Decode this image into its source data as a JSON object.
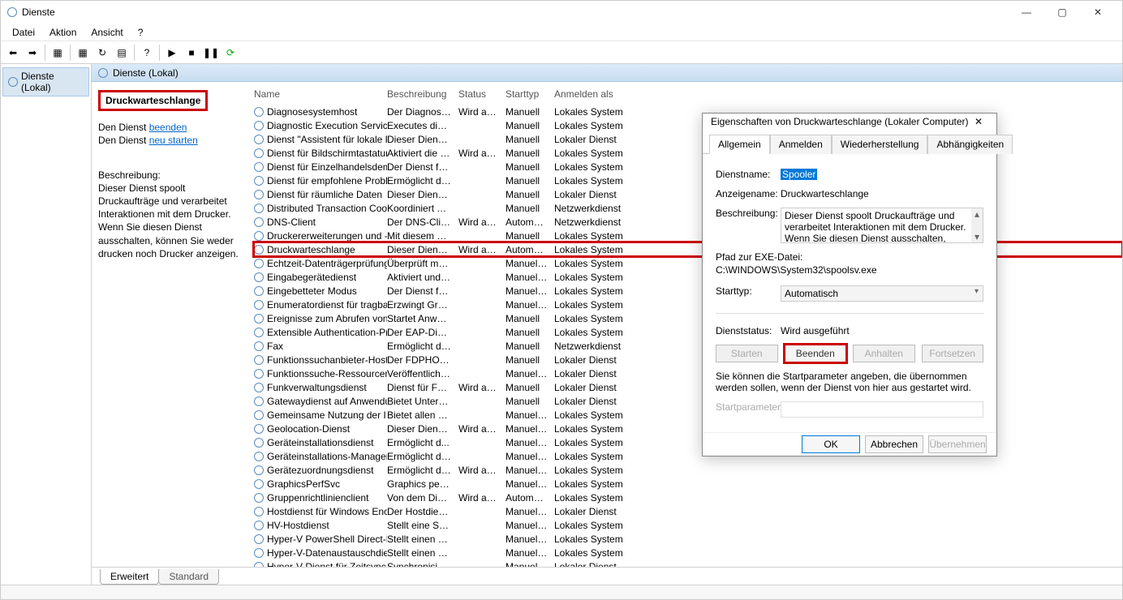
{
  "window_title": "Dienste",
  "menubar": {
    "file": "Datei",
    "action": "Aktion",
    "view": "Ansicht",
    "help": "?"
  },
  "tree": {
    "item0": "Dienste (Lokal)"
  },
  "panel_header": "Dienste (Lokal)",
  "detail": {
    "selected_service": "Druckwarteschlange",
    "line1_prefix": "Den Dienst ",
    "line1_link": "beenden",
    "line2_prefix": "Den Dienst ",
    "line2_link": "neu starten",
    "desc_label": "Beschreibung:",
    "desc_text": "Dieser Dienst spoolt Druckaufträge und verarbeitet Interaktionen mit dem Drucker. Wenn Sie diesen Dienst ausschalten, können Sie weder drucken noch Drucker anzeigen."
  },
  "columns": {
    "name": "Name",
    "desc": "Beschreibung",
    "status": "Status",
    "start": "Starttyp",
    "logon": "Anmelden als"
  },
  "rows": [
    {
      "name": "Diagnosesystemhost",
      "desc": "Der Diagnoses...",
      "status": "Wird au...",
      "start": "Manuell",
      "logon": "Lokales System",
      "hl": false
    },
    {
      "name": "Diagnostic Execution Service",
      "desc": "Executes diagn...",
      "status": "",
      "start": "Manuell",
      "logon": "Lokales System",
      "hl": false
    },
    {
      "name": "Dienst \"Assistent für lokale P...",
      "desc": "Dieser Dienst e...",
      "status": "",
      "start": "Manuell",
      "logon": "Lokaler Dienst",
      "hl": false
    },
    {
      "name": "Dienst für Bildschirmtastatur...",
      "desc": "Aktiviert die Sti...",
      "status": "Wird au...",
      "start": "Manuell",
      "logon": "Lokales System",
      "hl": false
    },
    {
      "name": "Dienst für Einzelhandelsdem...",
      "desc": "Der Dienst für ...",
      "status": "",
      "start": "Manuell",
      "logon": "Lokales System",
      "hl": false
    },
    {
      "name": "Dienst für empfohlene Probl...",
      "desc": "Ermöglicht de...",
      "status": "",
      "start": "Manuell",
      "logon": "Lokales System",
      "hl": false
    },
    {
      "name": "Dienst für räumliche Daten",
      "desc": "Dieser Dienst ...",
      "status": "",
      "start": "Manuell",
      "logon": "Lokaler Dienst",
      "hl": false
    },
    {
      "name": "Distributed Transaction Coor...",
      "desc": "Koordiniert Tra...",
      "status": "",
      "start": "Manuell",
      "logon": "Netzwerkdienst",
      "hl": false
    },
    {
      "name": "DNS-Client",
      "desc": "Der DNS-Clien...",
      "status": "Wird au...",
      "start": "Automat...",
      "logon": "Netzwerkdienst",
      "hl": false
    },
    {
      "name": "Druckererweiterungen und -...",
      "desc": "Mit diesem Die...",
      "status": "",
      "start": "Manuell",
      "logon": "Lokales System",
      "hl": false
    },
    {
      "name": "Druckwarteschlange",
      "desc": "Dieser Dienst s...",
      "status": "Wird au...",
      "start": "Automat...",
      "logon": "Lokales System",
      "hl": true
    },
    {
      "name": "Echtzeit-Datenträgerprüfung",
      "desc": "Überprüft mög...",
      "status": "",
      "start": "Manuell (...",
      "logon": "Lokales System",
      "hl": false
    },
    {
      "name": "Eingabegerätedienst",
      "desc": "Aktiviert und v...",
      "status": "",
      "start": "Manuell (...",
      "logon": "Lokales System",
      "hl": false
    },
    {
      "name": "Eingebetteter Modus",
      "desc": "Der Dienst für ...",
      "status": "",
      "start": "Manuell (...",
      "logon": "Lokales System",
      "hl": false
    },
    {
      "name": "Enumeratordienst für tragba...",
      "desc": "Erzwingt Grup...",
      "status": "",
      "start": "Manuell (...",
      "logon": "Lokales System",
      "hl": false
    },
    {
      "name": "Ereignisse zum Abrufen von s...",
      "desc": "Startet Anwen...",
      "status": "",
      "start": "Manuell",
      "logon": "Lokales System",
      "hl": false
    },
    {
      "name": "Extensible Authentication-Pr...",
      "desc": "Der EAP-Dienst...",
      "status": "",
      "start": "Manuell",
      "logon": "Lokales System",
      "hl": false
    },
    {
      "name": "Fax",
      "desc": "Ermöglicht das...",
      "status": "",
      "start": "Manuell",
      "logon": "Netzwerkdienst",
      "hl": false
    },
    {
      "name": "Funktionssuchanbieter-Host",
      "desc": "Der FDPHOST-...",
      "status": "",
      "start": "Manuell",
      "logon": "Lokaler Dienst",
      "hl": false
    },
    {
      "name": "Funktionssuche-Ressourcen...",
      "desc": "Veröffentlicht ...",
      "status": "",
      "start": "Manuell (...",
      "logon": "Lokaler Dienst",
      "hl": false
    },
    {
      "name": "Funkverwaltungsdienst",
      "desc": "Dienst für Fun...",
      "status": "Wird au...",
      "start": "Manuell",
      "logon": "Lokaler Dienst",
      "hl": false
    },
    {
      "name": "Gatewaydienst auf Anwendu...",
      "desc": "Bietet Unterstü...",
      "status": "",
      "start": "Manuell",
      "logon": "Lokaler Dienst",
      "hl": false
    },
    {
      "name": "Gemeinsame Nutzung der I...",
      "desc": "Bietet allen Co...",
      "status": "",
      "start": "Manuell (...",
      "logon": "Lokales System",
      "hl": false
    },
    {
      "name": "Geolocation-Dienst",
      "desc": "Dieser Dienst ü...",
      "status": "Wird au...",
      "start": "Manuell (...",
      "logon": "Lokales System",
      "hl": false
    },
    {
      "name": "Geräteinstallationsdienst",
      "desc": "Ermöglicht d...",
      "status": "",
      "start": "Manuell (...",
      "logon": "Lokales System",
      "hl": false
    },
    {
      "name": "Geräteinstallations-Manager",
      "desc": "Ermöglicht das...",
      "status": "",
      "start": "Manuell (...",
      "logon": "Lokales System",
      "hl": false
    },
    {
      "name": "Gerätezuordnungsdienst",
      "desc": "Ermöglicht die ...",
      "status": "Wird au...",
      "start": "Manuell (...",
      "logon": "Lokales System",
      "hl": false
    },
    {
      "name": "GraphicsPerfSvc",
      "desc": "Graphics perfo...",
      "status": "",
      "start": "Manuell (...",
      "logon": "Lokales System",
      "hl": false
    },
    {
      "name": "Gruppenrichtlinienclient",
      "desc": "Von dem Diens...",
      "status": "Wird au...",
      "start": "Automat...",
      "logon": "Lokales System",
      "hl": false
    },
    {
      "name": "Hostdienst für Windows Enc...",
      "desc": "Der Hostdienst...",
      "status": "",
      "start": "Manuell (...",
      "logon": "Lokaler Dienst",
      "hl": false
    },
    {
      "name": "HV-Hostdienst",
      "desc": "Stellt eine Sch...",
      "status": "",
      "start": "Manuell (...",
      "logon": "Lokales System",
      "hl": false
    },
    {
      "name": "Hyper-V PowerShell Direct-D...",
      "desc": "Stellt einen Me...",
      "status": "",
      "start": "Manuell (...",
      "logon": "Lokales System",
      "hl": false
    },
    {
      "name": "Hyper-V-Datenaustauschdie...",
      "desc": "Stellt einen Me...",
      "status": "",
      "start": "Manuell (...",
      "logon": "Lokales System",
      "hl": false
    },
    {
      "name": "Hyper-V-Dienst für Zeitsync...",
      "desc": "Synchronisiert ...",
      "status": "",
      "start": "Manuell (...",
      "logon": "Lokaler Dienst",
      "hl": false
    }
  ],
  "footer_tabs": {
    "extended": "Erweitert",
    "standard": "Standard"
  },
  "dialog": {
    "title": "Eigenschaften von Druckwarteschlange (Lokaler Computer)",
    "tabs": {
      "general": "Allgemein",
      "logon": "Anmelden",
      "recovery": "Wiederherstellung",
      "deps": "Abhängigkeiten"
    },
    "labels": {
      "svcname": "Dienstname:",
      "display": "Anzeigename:",
      "desc": "Beschreibung:",
      "exepath": "Pfad zur EXE-Datei:",
      "starttype": "Starttyp:",
      "status": "Dienststatus:",
      "startparam": "Startparameter:"
    },
    "values": {
      "svcname": "Spooler",
      "display": "Druckwarteschlange",
      "desc": "Dieser Dienst spoolt Druckaufträge und verarbeitet Interaktionen mit dem Drucker. Wenn Sie diesen Dienst ausschalten, können Sie weder drucken noch",
      "exepath": "C:\\WINDOWS\\System32\\spoolsv.exe",
      "starttype": "Automatisch",
      "status": "Wird ausgeführt"
    },
    "hint": "Sie können die Startparameter angeben, die übernommen werden sollen, wenn der Dienst von hier aus gestartet wird.",
    "buttons": {
      "start": "Starten",
      "stop": "Beenden",
      "pause": "Anhalten",
      "resume": "Fortsetzen",
      "ok": "OK",
      "cancel": "Abbrechen",
      "apply": "Übernehmen"
    }
  }
}
